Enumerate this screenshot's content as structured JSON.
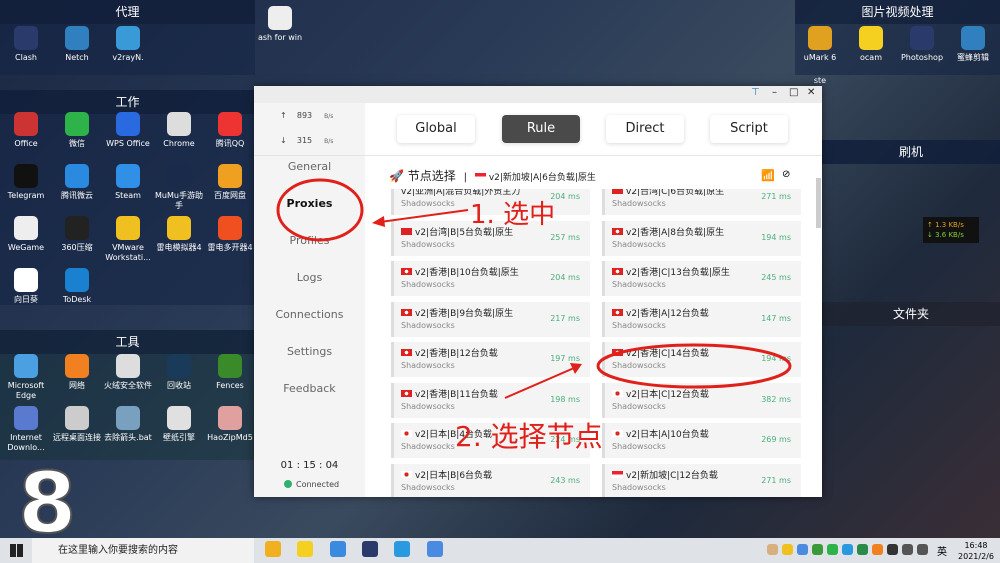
{
  "desktop": {
    "fences": [
      {
        "title": "代理",
        "icons": [
          "Clash",
          "Netch",
          "v2rayN."
        ]
      },
      {
        "title": "工作",
        "icons": [
          "Office",
          "微信",
          "WPS Office",
          "Chrome",
          "腾讯QQ",
          "Telegram",
          "腾讯微云",
          "Steam",
          "MuMu手游助手",
          "百度网盘",
          "WeGame",
          "360压缩",
          "VMware Workstati...",
          "雷电模拟器4",
          "雷电多开器4",
          "向日葵",
          "ToDesk"
        ]
      },
      {
        "title": "工具",
        "icons": [
          "Microsoft Edge",
          "网络",
          "火绒安全软件",
          "回收站",
          "Fences",
          "Internet Downlo...",
          "远程桌面连接",
          "去除箭头.bat",
          "壁纸引擎",
          "HaoZipMd5"
        ]
      },
      {
        "title": "图片视频处理",
        "icons": [
          "uMark 6",
          "ocam",
          "Photoshop",
          "蜜蜂剪辑"
        ]
      },
      {
        "title": "刷机",
        "icons": []
      },
      {
        "title": "文件夹",
        "icons": []
      }
    ],
    "partial_icons": [
      "ash for win",
      "ste"
    ],
    "episode_number": "8",
    "net_monitor": {
      "up": "↑ 1.3 KB/s",
      "down": "↓ 3.6 KB/s"
    }
  },
  "window": {
    "traffic": {
      "up_value": "893",
      "down_value": "315",
      "unit": "B/s",
      "up_arrow": "↑",
      "down_arrow": "↓"
    },
    "nav": [
      "General",
      "Proxies",
      "Profiles",
      "Logs",
      "Connections",
      "Settings",
      "Feedback"
    ],
    "active_nav": "Proxies",
    "timer": "01 : 15 : 04",
    "status": "Connected",
    "modes": [
      "Global",
      "Rule",
      "Direct",
      "Script"
    ],
    "active_mode": "Rule",
    "group": {
      "title": "节点选择",
      "separator": "|",
      "selected": "v2|新加坡|A|6台负载|原生"
    },
    "proxies": [
      {
        "name": "v2|亚洲|A|混合负载|外贸主力",
        "type": "Shadowsocks",
        "delay": "204 ms",
        "flag": "none"
      },
      {
        "name": "v2|台湾|C|6台负载|原生",
        "type": "Shadowsocks",
        "delay": "271 ms",
        "flag": "tw"
      },
      {
        "name": "v2|台湾|B|5台负载|原生",
        "type": "Shadowsocks",
        "delay": "257 ms",
        "flag": "tw"
      },
      {
        "name": "v2|香港|A|8台负载|原生",
        "type": "Shadowsocks",
        "delay": "194 ms",
        "flag": "hk"
      },
      {
        "name": "v2|香港|B|10台负载|原生",
        "type": "Shadowsocks",
        "delay": "204 ms",
        "flag": "hk"
      },
      {
        "name": "v2|香港|C|13台负载|原生",
        "type": "Shadowsocks",
        "delay": "245 ms",
        "flag": "hk"
      },
      {
        "name": "v2|香港|B|9台负载|原生",
        "type": "Shadowsocks",
        "delay": "217 ms",
        "flag": "hk"
      },
      {
        "name": "v2|香港|A|12台负载",
        "type": "Shadowsocks",
        "delay": "147 ms",
        "flag": "hk"
      },
      {
        "name": "v2|香港|B|12台负载",
        "type": "Shadowsocks",
        "delay": "197 ms",
        "flag": "hk"
      },
      {
        "name": "v2|香港|C|14台负载",
        "type": "Shadowsocks",
        "delay": "194 ms",
        "flag": "hk"
      },
      {
        "name": "v2|香港|B|11台负载",
        "type": "Shadowsocks",
        "delay": "198 ms",
        "flag": "hk"
      },
      {
        "name": "v2|日本|C|12台负载",
        "type": "Shadowsocks",
        "delay": "382 ms",
        "flag": "jp"
      },
      {
        "name": "v2|日本|B|4台负载",
        "type": "Shadowsocks",
        "delay": "224 ms",
        "flag": "jp"
      },
      {
        "name": "v2|日本|A|10台负载",
        "type": "Shadowsocks",
        "delay": "269 ms",
        "flag": "jp"
      },
      {
        "name": "v2|日本|B|6台负载",
        "type": "Shadowsocks",
        "delay": "243 ms",
        "flag": "jp"
      },
      {
        "name": "v2|新加坡|C|12台负载",
        "type": "Shadowsocks",
        "delay": "271 ms",
        "flag": "sg"
      }
    ]
  },
  "annotations": {
    "step1": "1. 选中",
    "step2": "2. 选择节点"
  },
  "taskbar": {
    "search_placeholder": "在这里输入你要搜索的内容",
    "time": "16:48",
    "date": "2021/2/6",
    "ime": "英"
  },
  "colors": {
    "annotation": "#e0201a",
    "delay": "#4caf7a",
    "active_mode": "#4a4a4a",
    "connected": "#2db36f"
  }
}
